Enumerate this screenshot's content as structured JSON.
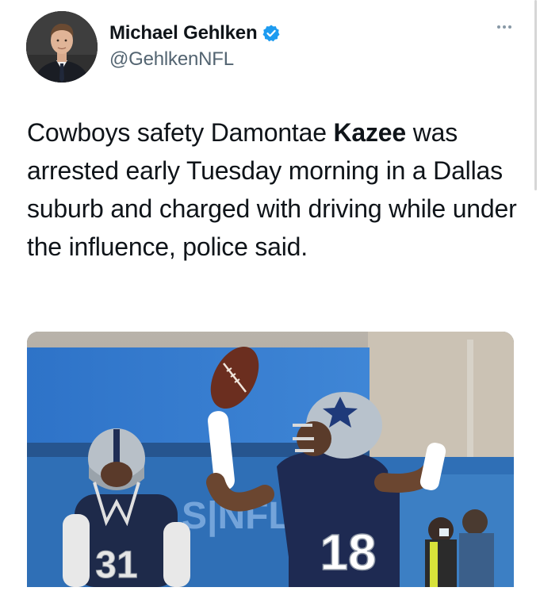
{
  "author": {
    "display_name": "Michael Gehlken",
    "handle": "@GehlkenNFL",
    "verified": true,
    "verified_color": "#1d9bf0",
    "avatar_icon": "profile-photo"
  },
  "tweet": {
    "text_before": "Cowboys safety Damontae ",
    "text_bold": "Kazee",
    "text_after": " was arrested early Tuesday morning in a Dallas suburb and charged with driving while under the influence, police said."
  },
  "media": {
    "banner_text": "S|NFL",
    "left_player_number": "31",
    "right_player_number": "18"
  },
  "icons": {
    "more_menu": "more-dots-icon",
    "verified": "verified-badge-icon"
  }
}
